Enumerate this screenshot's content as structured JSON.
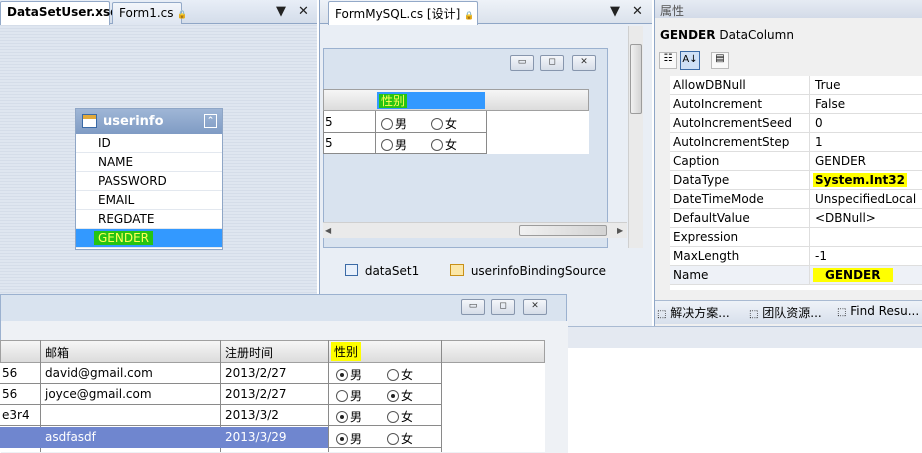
{
  "left_pane": {
    "tabs": [
      {
        "label": "DataSetUser.xsd"
      },
      {
        "label": "Form1.cs"
      }
    ],
    "lock_icon": "🔒",
    "ctrl_dropdown": "▼",
    "ctrl_close": "✕",
    "table": {
      "name": "userinfo",
      "collapse": "⌃",
      "columns": [
        "ID",
        "NAME",
        "PASSWORD",
        "EMAIL",
        "REGDATE",
        "GENDER"
      ],
      "selected": "GENDER"
    }
  },
  "mid_pane": {
    "tab_label": "FormMySQL.cs [设计]",
    "lock_icon": "🔒",
    "ctrl_dropdown": "▼",
    "ctrl_close": "✕",
    "win_min": "▭",
    "win_max": "◻",
    "win_close": "✕",
    "grid": {
      "header_gender": "性别",
      "rows": [
        {
          "lead": "5",
          "male": "男",
          "female": "女"
        },
        {
          "lead": "5",
          "male": "男",
          "female": "女"
        }
      ]
    },
    "components": [
      {
        "label": "dataSet1",
        "icon": "dataset-icon"
      },
      {
        "label": "userinfoBindingSource",
        "icon": "binding-source-icon"
      }
    ]
  },
  "prop_pane": {
    "title": "属性",
    "object_name": "GENDER",
    "object_type": "DataColumn",
    "rows": [
      {
        "name": "AllowDBNull",
        "value": "True"
      },
      {
        "name": "AutoIncrement",
        "value": "False"
      },
      {
        "name": "AutoIncrementSeed",
        "value": "0"
      },
      {
        "name": "AutoIncrementStep",
        "value": "1"
      },
      {
        "name": "Caption",
        "value": "GENDER"
      },
      {
        "name": "DataType",
        "value": "System.Int32"
      },
      {
        "name": "DateTimeMode",
        "value": "UnspecifiedLocal"
      },
      {
        "name": "DefaultValue",
        "value": "<DBNull>"
      },
      {
        "name": "Expression",
        "value": ""
      },
      {
        "name": "MaxLength",
        "value": "-1"
      },
      {
        "name": "Name",
        "value": "GENDER"
      }
    ],
    "bottom_tabs": [
      {
        "label": "解决方案..."
      },
      {
        "label": "团队资源..."
      },
      {
        "label": "Find Resu..."
      }
    ]
  },
  "run_form": {
    "win_min": "▭",
    "win_max": "◻",
    "win_close": "✕",
    "headers": {
      "email": "邮箱",
      "regdate": "注册时间",
      "gender": "性别"
    },
    "rows": [
      {
        "lead": "56",
        "email": "david@gmail.com",
        "date": "2013/2/27",
        "male": "男",
        "female": "女",
        "gender": "male"
      },
      {
        "lead": "56",
        "email": "joyce@gmail.com",
        "date": "2013/2/27",
        "male": "男",
        "female": "女",
        "gender": "female"
      },
      {
        "lead": "e3r4",
        "email": "",
        "date": "2013/3/2",
        "male": "男",
        "female": "女",
        "gender": "male"
      },
      {
        "lead": "",
        "email": "asdfasdf",
        "date": "2013/3/29",
        "male": "男",
        "female": "女",
        "gender": "male"
      }
    ]
  },
  "colors": {
    "selection_blue": "#3399ff",
    "highlight_yellow": "#ffff00",
    "highlight_green": "#26c413"
  }
}
